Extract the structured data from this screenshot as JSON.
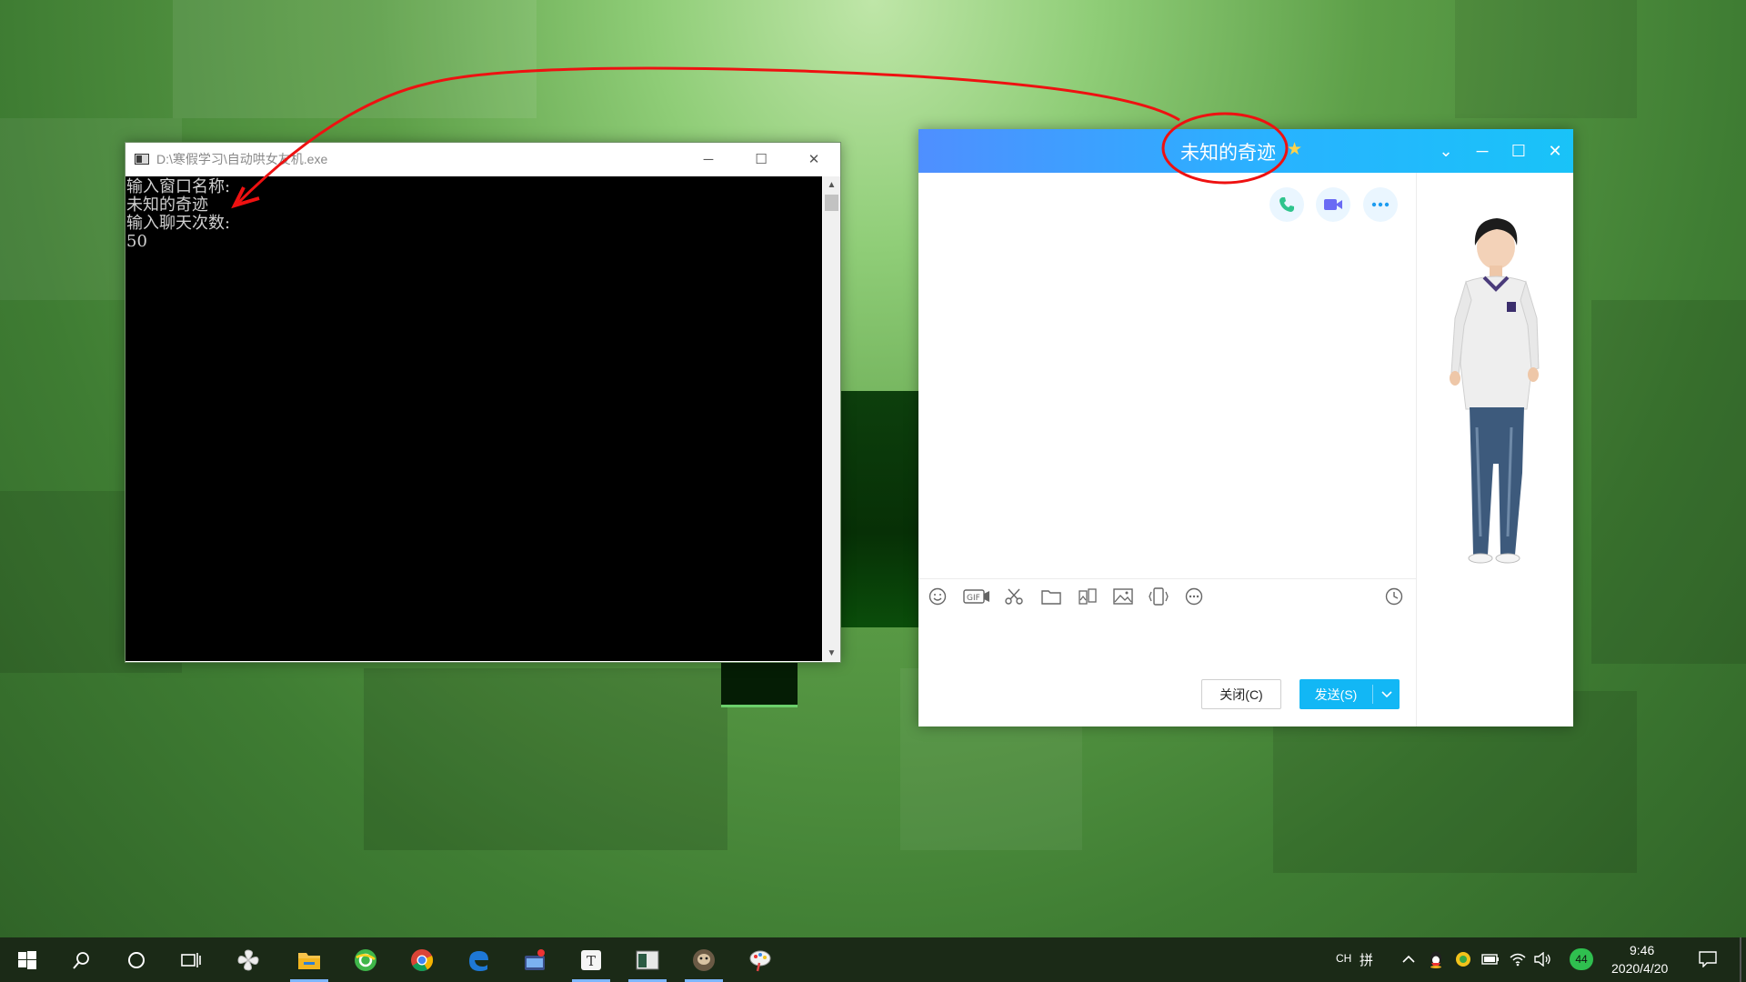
{
  "console": {
    "title": "D:\\寒假学习\\自动哄女友机.exe",
    "lines": [
      "输入窗口名称:",
      "未知的奇迹",
      "输入聊天次数:",
      "50"
    ],
    "controls": {
      "minimize": "─",
      "maximize": "☐",
      "close": "✕"
    }
  },
  "chat": {
    "title": "未知的奇迹",
    "title_badge_icon": "star-icon",
    "window_controls": {
      "dropdown": "⌄",
      "minimize": "─",
      "maximize": "☐",
      "close": "✕"
    },
    "call_buttons": [
      "phone-call-icon",
      "video-call-icon",
      "more-icon"
    ],
    "toolbar_tools": [
      "emoji-icon",
      "gif-icon",
      "scissors-icon",
      "folder-icon",
      "gallery-icon",
      "image-icon",
      "shake-icon",
      "more-circle-icon"
    ],
    "history_icon": "clock-icon",
    "close_button": "关闭(C)",
    "send_button": "发送(S)",
    "send_dropdown": "⌄",
    "colors": {
      "header_start": "#4f8fff",
      "header_end": "#19c3f8",
      "send": "#12b7f5"
    }
  },
  "taskbar": {
    "apps": [
      "start-icon",
      "search-icon",
      "cortana-icon",
      "task-view-icon",
      "pinwheel-icon",
      "file-explorer-icon",
      "360-browser-icon",
      "chrome-icon",
      "edge-icon",
      "media-app-icon",
      "typora-icon",
      "console-app-icon",
      "game-app-icon",
      "paint-app-icon"
    ],
    "tray": {
      "lang": "CH",
      "ime": "拼",
      "badge": "44",
      "time": "9:46",
      "date": "2020/4/20"
    }
  }
}
